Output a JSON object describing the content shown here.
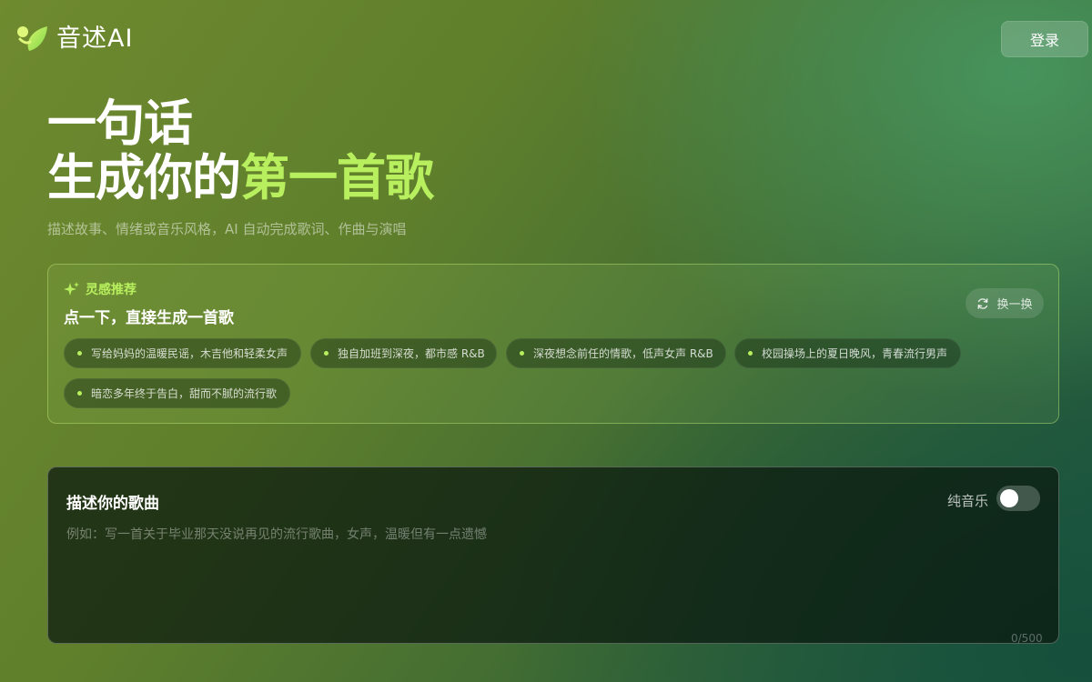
{
  "brand": {
    "name": "音述AI",
    "logo_icon": "music-leaf-logo",
    "accent_color": "#b7ef5e"
  },
  "header": {
    "login_label": "登录"
  },
  "hero": {
    "line1": "一句话",
    "line2_prefix": "生成你的",
    "line2_accent": "第一首歌",
    "subtitle": "描述故事、情绪或音乐风格，AI 自动完成歌词、作曲与演唱"
  },
  "inspiration": {
    "icon": "sparkle-icon",
    "title": "灵感推荐",
    "subtitle": "点一下，直接生成一首歌",
    "refresh_icon": "refresh-icon",
    "refresh_label": "换一换",
    "chips": [
      "写给妈妈的温暖民谣，木吉他和轻柔女声",
      "独自加班到深夜，都市感 R&B",
      "深夜想念前任的情歌，低声女声 R&B",
      "校园操场上的夏日晚风，青春流行男声",
      "暗恋多年终于告白，甜而不腻的流行歌"
    ]
  },
  "composer": {
    "title": "描述你的歌曲",
    "pure_music_label": "纯音乐",
    "pure_music_on": false,
    "input_value": "",
    "input_placeholder": "例如：写一首关于毕业那天没说再见的流行歌曲，女声，温暖但有一点遗憾",
    "char_count": "0/500"
  }
}
